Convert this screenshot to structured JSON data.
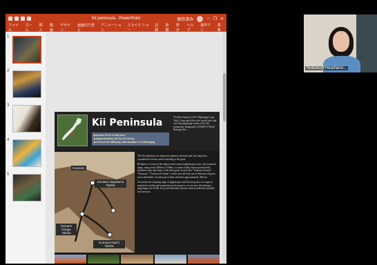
{
  "powerpoint": {
    "document_title": "Kii peninsula - PowerPoint",
    "ribbon_tabs": [
      "ファイル",
      "ホーム",
      "挿入",
      "描画",
      "デザイン",
      "画面切り替え",
      "アニメーション",
      "スライド ショー",
      "記録",
      "校閲",
      "表示",
      "ヘルプ",
      "操作アシ"
    ],
    "share_label": "共有",
    "account_status": "保存済み"
  },
  "thumbnails": [
    {
      "number": "1"
    },
    {
      "number": "2"
    },
    {
      "number": "3"
    },
    {
      "number": "4"
    },
    {
      "number": "5"
    }
  ],
  "slide": {
    "title": "Kii Peninsula",
    "facts": [
      "Around 10 to 14 day tour",
      "Approximately 100 km (70 miles)",
      "Level of the difficulty: Intermediate to Challenging"
    ],
    "intro": "70 miles Journey of the Pilgrimage Long Trail. Come and follow the sacred sites and visit the pilgrimage routes of the Kii mountains, designated a UNESCO World Heritage Site.",
    "map_labels": {
      "koyasan": "Koyasan",
      "hayatama": "Kumano Hayatama Taisha",
      "hongu": "Kumano Hongu Taisha",
      "nachi": "Kumano Nachi Taisha"
    },
    "paragraphs": [
      "The Kii peninsula, an important Japanese spiritual land, has long been considered to be the sacred dwelling of the gods.",
      "Birthplace of some of the Japan's most ancient pilgrimage routes, the mountain range, rising from 1000m to 1500m, is a land of deep forests protected by bountiful rains and home of the three great sacred sites, \"Kumano Sanzan\", \"Koyasan\", \"Yoshino & Omine\", which were all born out of different religious roots and beliefs. Its network of trails stretches approximately 300 km.",
      "Set amidst the stunning stage of pilgrimage trails that long alive its origin of mountain worship and mountain ascetic practice, we are now developing a pilgrimage tour of Mt. Koya and Kumano Sanzan's almost endlessly stranded trail network."
    ]
  },
  "webcam": {
    "participant_name": "Nobuko@Heartland..."
  }
}
